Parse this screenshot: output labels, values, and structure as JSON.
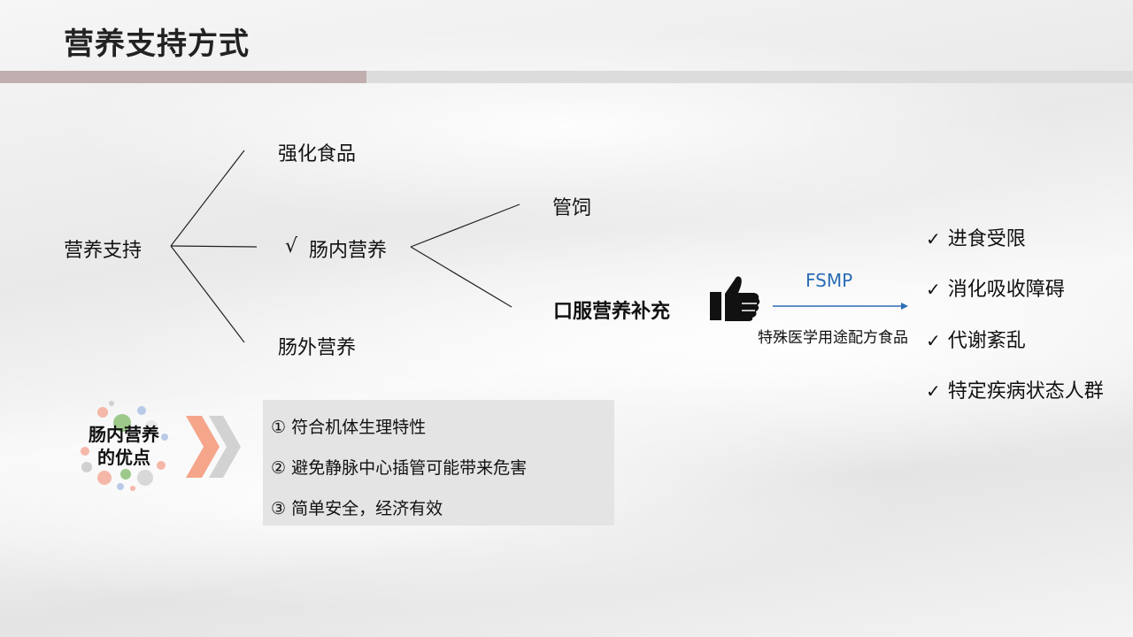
{
  "page": {
    "title": "营养支持方式"
  },
  "tree": {
    "root": "营养支持",
    "branch_fortified": "强化食品",
    "branch_enteral_mark": "√",
    "branch_enteral": "肠内营养",
    "branch_parenteral": "肠外营养",
    "sub_tube": "管饲",
    "sub_oral": "口服营养补充"
  },
  "fsmp": {
    "abbr": "FSMP",
    "full": "特殊医学用途配方食品"
  },
  "indications": {
    "check_glyph": "✓",
    "items": [
      "进食受限",
      "消化吸收障碍",
      "代谢紊乱",
      "特定疾病状态人群"
    ]
  },
  "advantages": {
    "title_line1": "肠内营养",
    "title_line2": "的优点",
    "items": [
      "① 符合机体生理特性",
      "② 避免静脉中心插管可能带来危害",
      "③ 简单安全，经济有效"
    ]
  },
  "colors": {
    "accent_bar": "#c1aeae",
    "fsmp_blue": "#2a6db5",
    "chevron_orange": "#f4a58a"
  }
}
